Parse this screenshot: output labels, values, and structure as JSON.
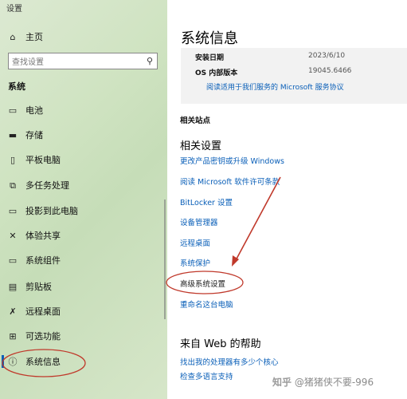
{
  "app": {
    "title": "设置"
  },
  "sidebar": {
    "home": {
      "label": "主页",
      "icon": "home-icon"
    },
    "search": {
      "placeholder": "查找设置"
    },
    "section": "系统",
    "items": [
      {
        "label": "电池",
        "icon": "battery-icon"
      },
      {
        "label": "存储",
        "icon": "storage-icon"
      },
      {
        "label": "平板电脑",
        "icon": "tablet-icon"
      },
      {
        "label": "多任务处理",
        "icon": "multitask-icon"
      },
      {
        "label": "投影到此电脑",
        "icon": "project-icon"
      },
      {
        "label": "体验共享",
        "icon": "share-icon"
      },
      {
        "label": "系统组件",
        "icon": "components-icon"
      },
      {
        "label": "剪贴板",
        "icon": "clipboard-icon"
      },
      {
        "label": "远程桌面",
        "icon": "remote-icon"
      },
      {
        "label": "可选功能",
        "icon": "optional-features-icon"
      },
      {
        "label": "系统信息",
        "icon": "info-icon",
        "active": true
      }
    ]
  },
  "main": {
    "title": "系统信息",
    "specs": [
      {
        "key": "安装日期",
        "value": "2023/6/10"
      },
      {
        "key": "OS 内部版本",
        "value": "19045.6466"
      }
    ],
    "service_link": "阅读适用于我们服务的 Microsoft 服务协议",
    "related_sites": "相关站点",
    "related_settings": {
      "heading": "相关设置",
      "links": [
        "更改产品密钥或升级 Windows",
        "阅读 Microsoft 软件许可条款",
        "BitLocker 设置",
        "设备管理器",
        "远程桌面",
        "系统保护",
        "高级系统设置",
        "重命名这台电脑"
      ]
    },
    "web_help": {
      "heading": "来自 Web 的帮助",
      "links": [
        "找出我的处理器有多少个核心",
        "检查多语言支持"
      ]
    }
  },
  "watermark": {
    "logo": "知乎",
    "text": "@猪猪侠不要-996"
  },
  "colors": {
    "accent": "#0a5fb8",
    "annotation": "#c0392b"
  }
}
